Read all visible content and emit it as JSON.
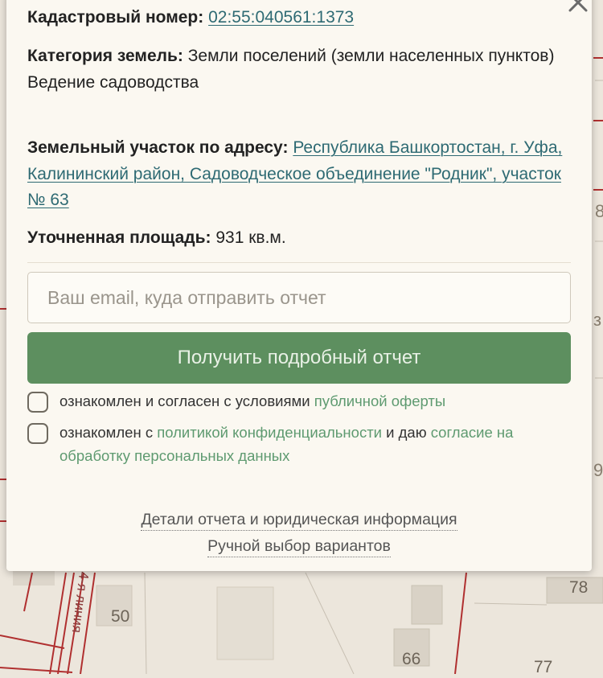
{
  "map": {
    "house_numbers": [
      "50",
      "78",
      "66",
      "77"
    ],
    "street_name": "4-я линия",
    "edge_glyphs": [
      "8",
      "з",
      "9"
    ]
  },
  "popup": {
    "close_glyph": "×",
    "cadastral": {
      "label": "Кадастровый номер:",
      "value": "02:55:040561:1373"
    },
    "category": {
      "label": "Категория земель:",
      "value": "Земли поселений (земли населенных пунктов)",
      "usage": "Ведение садоводства"
    },
    "address": {
      "label": "Земельный участок по адресу:",
      "value": "Республика Башкортостан, г. Уфа, Калининский район, Садоводческое объединение \"Родник\", участок № 63"
    },
    "area": {
      "label": "Уточненная площадь:",
      "value": "931 кв.м."
    },
    "email": {
      "placeholder": "Ваш email, куда отправить отчет",
      "value": ""
    },
    "submit_label": "Получить подробный отчет",
    "consent_offer": {
      "text": "ознакомлен и согласен с условиями ",
      "link": "публичной оферты",
      "checked": false
    },
    "consent_privacy": {
      "text_before": "ознакомлен с ",
      "link_policy": "политикой конфиденциальности",
      "text_middle": " и даю ",
      "link_consent": "согласие на обработку персональных данных",
      "checked": false
    },
    "footer_links": {
      "details": "Детали отчета и юридическая информация",
      "manual": "Ручной выбор вариантов"
    }
  },
  "colors": {
    "button": "#5d8f5f",
    "link": "#2e6a73",
    "green_link": "#5e9a70",
    "map_road": "#b03030"
  }
}
